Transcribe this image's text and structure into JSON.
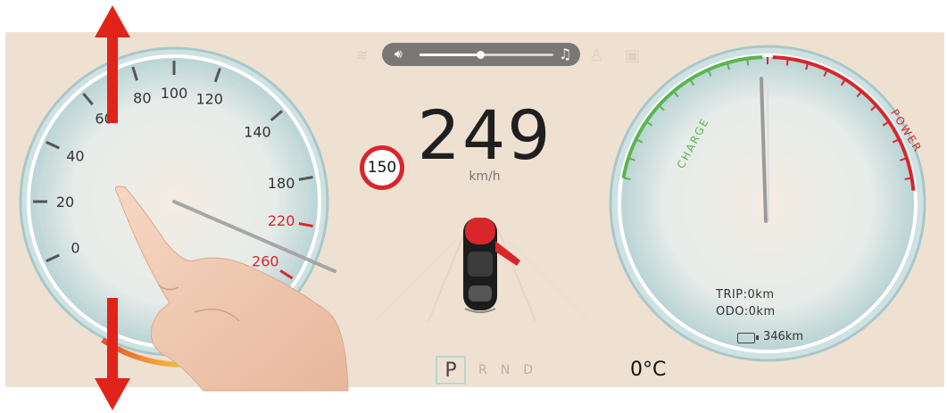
{
  "speedometer": {
    "tick_labels": [
      "0",
      "20",
      "40",
      "60",
      "80",
      "100",
      "120",
      "140",
      "180",
      "220",
      "260"
    ],
    "needle_speed": 230
  },
  "center": {
    "speed_value": "249",
    "speed_unit": "km/h",
    "speed_limit": "150"
  },
  "media": {
    "volume_level": 0.45,
    "volume_icon": "speaker-icon",
    "music_icon": "music-note-icon"
  },
  "power_meter": {
    "charge_label": "CHARGE",
    "power_label": "POWER",
    "trip_label": "TRIP:",
    "trip_value": "0km",
    "odo_label": "ODO:",
    "odo_value": "0km",
    "range_value": "346km"
  },
  "gear_selector": {
    "selected": "P",
    "others": [
      "R",
      "N",
      "D"
    ]
  },
  "temperature": "0°C",
  "colors": {
    "panel_bg": "#efe1d1",
    "accent_red": "#d8262b",
    "charge_green": "#5ab550",
    "arrow_red": "#e2231a"
  }
}
